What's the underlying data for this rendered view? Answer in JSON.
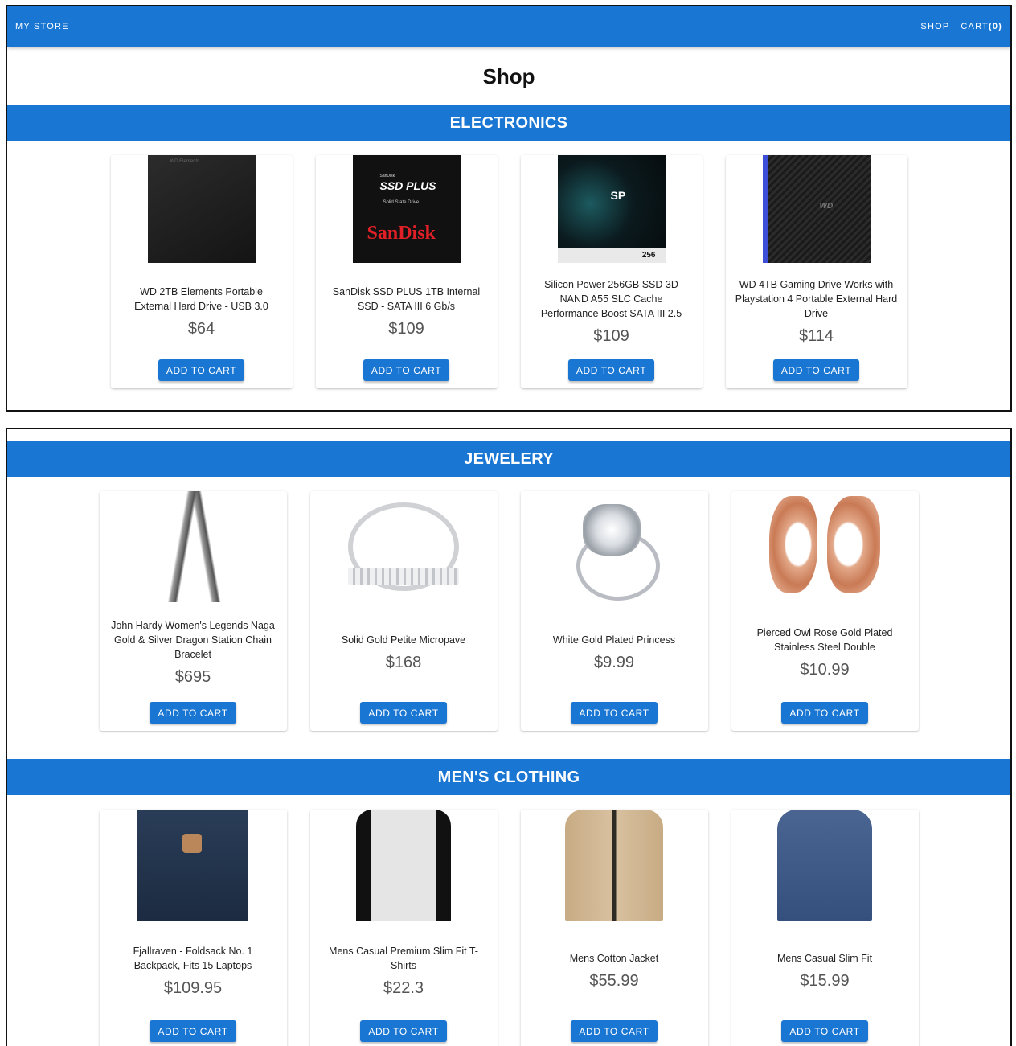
{
  "header": {
    "brand": "MY STORE",
    "nav_shop": "SHOP",
    "nav_cart": "CART",
    "cart_count": "(0)"
  },
  "page": {
    "title": "Shop"
  },
  "colors": {
    "primary": "#1976d2"
  },
  "categories": {
    "electronics": {
      "title": "ELECTRONICS",
      "products": [
        {
          "title": "WD 2TB Elements Portable External Hard Drive - USB 3.0",
          "price": "$64",
          "button": "ADD TO CART",
          "image_label": "WD Elements"
        },
        {
          "title": "SanDisk SSD PLUS 1TB Internal SSD - SATA III 6 Gb/s",
          "price": "$109",
          "button": "ADD TO CART",
          "image_small": "SanDisk",
          "image_big": "SSD PLUS",
          "image_sub": "Solid State Drive",
          "image_logo": "SanDisk"
        },
        {
          "title": "Silicon Power 256GB SSD 3D NAND A55 SLC Cache Performance Boost SATA III 2.5",
          "price": "$109",
          "button": "ADD TO CART",
          "image_logo": "SP",
          "image_cap": "256"
        },
        {
          "title": "WD 4TB Gaming Drive Works with Playstation 4 Portable External Hard Drive",
          "price": "$114",
          "button": "ADD TO CART",
          "image_logo": "WD"
        }
      ]
    },
    "jewelery": {
      "title": "JEWELERY",
      "products": [
        {
          "title": "John Hardy Women's Legends Naga Gold & Silver Dragon Station Chain Bracelet",
          "price": "$695",
          "button": "ADD TO CART"
        },
        {
          "title": "Solid Gold Petite Micropave",
          "price": "$168",
          "button": "ADD TO CART"
        },
        {
          "title": "White Gold Plated Princess",
          "price": "$9.99",
          "button": "ADD TO CART"
        },
        {
          "title": "Pierced Owl Rose Gold Plated Stainless Steel Double",
          "price": "$10.99",
          "button": "ADD TO CART"
        }
      ]
    },
    "mens": {
      "title": "MEN'S CLOTHING",
      "products": [
        {
          "title": "Fjallraven - Foldsack No. 1 Backpack, Fits 15 Laptops",
          "price": "$109.95",
          "button": "ADD TO CART"
        },
        {
          "title": "Mens Casual Premium Slim Fit T-Shirts",
          "price": "$22.3",
          "button": "ADD TO CART"
        },
        {
          "title": "Mens Cotton Jacket",
          "price": "$55.99",
          "button": "ADD TO CART"
        },
        {
          "title": "Mens Casual Slim Fit",
          "price": "$15.99",
          "button": "ADD TO CART"
        }
      ]
    }
  }
}
